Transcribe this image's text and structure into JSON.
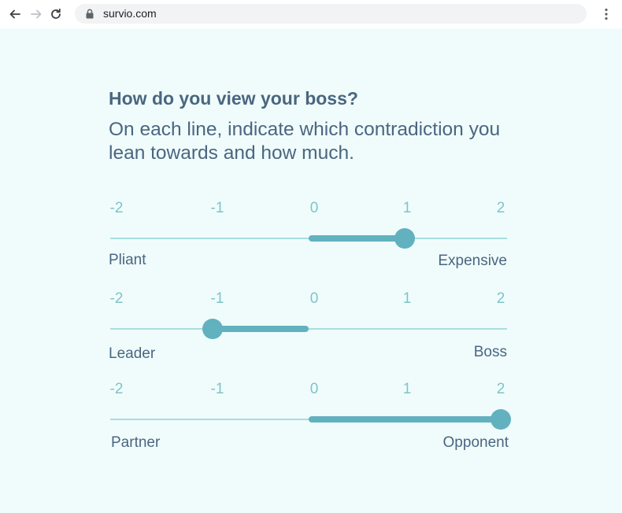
{
  "browser": {
    "url": "survio.com",
    "icons": {
      "back": "arrow-left-icon",
      "forward": "arrow-right-icon",
      "reload": "reload-icon",
      "lock": "lock-icon",
      "menu": "kebab-menu-icon"
    }
  },
  "survey": {
    "question": "How do you view your boss?",
    "instruction": "On each line, indicate which contradiction you lean towards and how much.",
    "scale_ticks": [
      "-2",
      "-1",
      "0",
      "1",
      "2"
    ],
    "sliders": [
      {
        "left_label": "Pliant",
        "right_label": "Expensive",
        "value": 1
      },
      {
        "left_label": "Leader",
        "right_label": "Boss",
        "value": -1
      },
      {
        "left_label": "Partner",
        "right_label": "Opponent",
        "value": 2
      }
    ]
  },
  "colors": {
    "background": "#f0fcfc",
    "text": "#4a6680",
    "tick": "#7ec4c8",
    "accent": "#62b1bf",
    "track": "#a9dde0"
  }
}
